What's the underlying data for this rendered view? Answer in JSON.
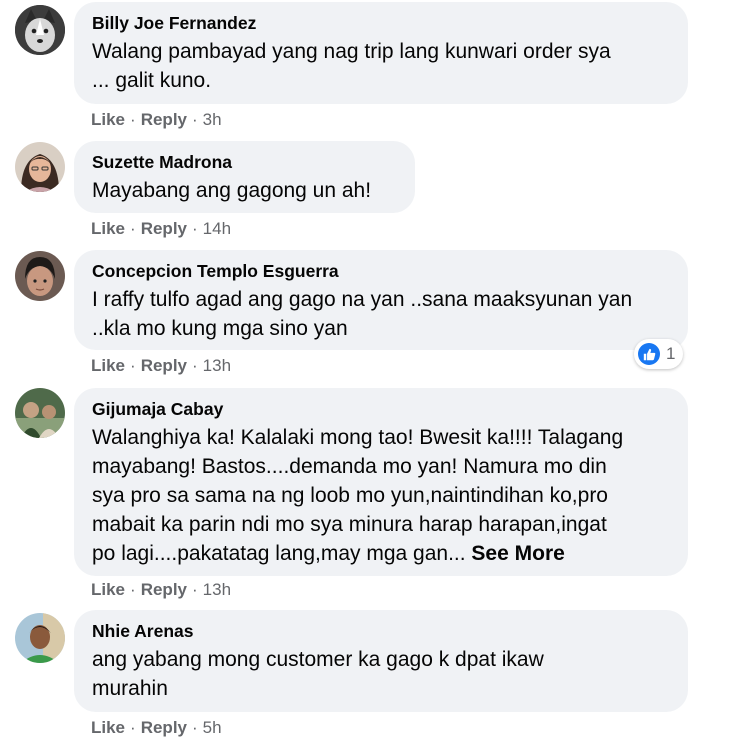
{
  "comments": [
    {
      "author": "Billy Joe Fernandez",
      "lines": [
        "Walang pambayad yang nag trip lang kunwari order sya",
        "... galit kuno."
      ],
      "like": "Like",
      "reply": "Reply",
      "time": "3h"
    },
    {
      "author": "Suzette Madrona",
      "lines": [
        "Mayabang ang gagong un ah!"
      ],
      "like": "Like",
      "reply": "Reply",
      "time": "14h"
    },
    {
      "author": "Concepcion Templo Esguerra",
      "lines": [
        "I raffy tulfo agad ang gago na yan ..sana maaksyunan yan",
        "..kla mo kung mga sino yan"
      ],
      "like": "Like",
      "reply": "Reply",
      "time": "13h",
      "reaction_count": "1"
    },
    {
      "author": "Gijumaja Cabay",
      "lines": [
        "Walanghiya ka! Kalalaki mong tao! Bwesit ka!!!! Talagang",
        "mayabang! Bastos....demanda mo yan! Namura mo din",
        "sya pro sa sama na ng loob mo yun,naintindihan ko,pro",
        "mabait ka parin ndi mo sya minura harap harapan,ingat",
        "po lagi....pakatatag lang,may mga gan..."
      ],
      "see_more": "See More",
      "like": "Like",
      "reply": "Reply",
      "time": "13h"
    },
    {
      "author": "Nhie Arenas",
      "lines": [
        "ang yabang mong customer ka gago k dpat ikaw",
        "murahin"
      ],
      "like": "Like",
      "reply": "Reply",
      "time": "5h"
    }
  ],
  "separator": "·",
  "colors": {
    "bubble": "#f0f2f5",
    "meta_text": "#65676b",
    "like_blue": "#1877f2"
  },
  "icons": {
    "reaction": "thumbs-up-icon"
  }
}
